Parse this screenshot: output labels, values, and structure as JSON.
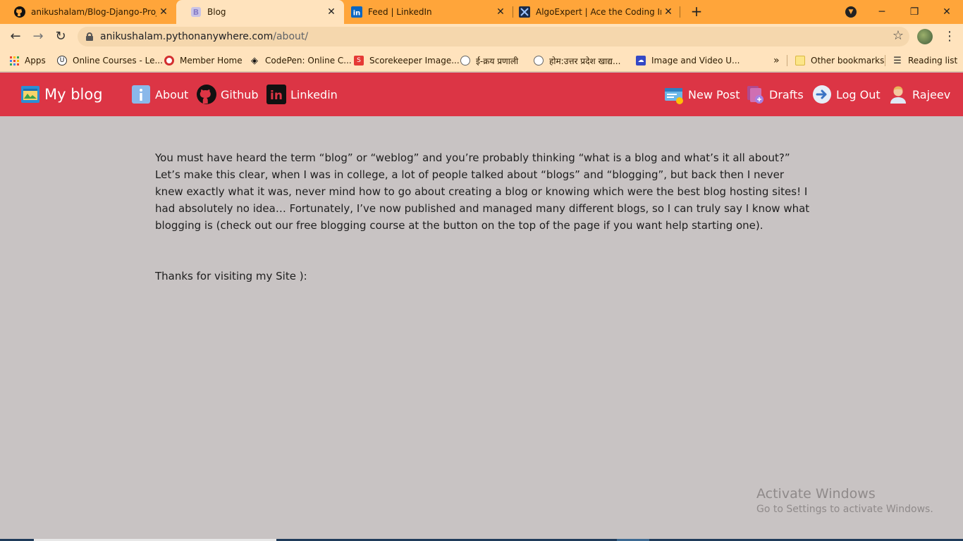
{
  "browser": {
    "tabs": [
      {
        "title": "anikushalam/Blog-Django-Projec",
        "icon": "github-icon",
        "active": false
      },
      {
        "title": "Blog",
        "icon": "bootstrap-icon",
        "active": true
      },
      {
        "title": "Feed | LinkedIn",
        "icon": "linkedin-icon",
        "active": false
      },
      {
        "title": "AlgoExpert | Ace the Coding Inte",
        "icon": "algoexpert-icon",
        "active": false
      }
    ],
    "new_tab": "+",
    "window_controls": {
      "minimize": "─",
      "restore": "❐",
      "close": "✕"
    },
    "url_host": "anikushalam.pythonanywhere.com",
    "url_path": "/about/",
    "bookmarks": [
      {
        "label": "Apps",
        "icon": "apps-grid-icon"
      },
      {
        "label": "Online Courses - Le...",
        "icon": "udemy-icon"
      },
      {
        "label": "Member Home",
        "icon": "member-home-icon"
      },
      {
        "label": "CodePen: Online C...",
        "icon": "codepen-icon"
      },
      {
        "label": "Scorekeeper Image...",
        "icon": "scorekeeper-icon"
      },
      {
        "label": "ई-क्रय प्रणाली",
        "icon": "up-emblem-icon"
      },
      {
        "label": "होम:उत्तर प्रदेश खाद्य...",
        "icon": "up-emblem-icon"
      },
      {
        "label": "Image and Video U...",
        "icon": "cloud-upload-icon"
      }
    ],
    "more_bookmarks": "»",
    "other_bookmarks": "Other bookmarks",
    "reading_list": "Reading list"
  },
  "navbar": {
    "brand": "My blog",
    "left_items": [
      {
        "label": "About",
        "icon": "info-icon"
      },
      {
        "label": "Github",
        "icon": "github-icon"
      },
      {
        "label": "Linkedin",
        "icon": "linkedin-icon"
      }
    ],
    "right_items": [
      {
        "label": "New Post",
        "icon": "new-post-icon"
      },
      {
        "label": "Drafts",
        "icon": "drafts-icon"
      },
      {
        "label": "Log Out",
        "icon": "logout-arrow-icon"
      },
      {
        "label": "Rajeev",
        "icon": "user-avatar-icon"
      }
    ]
  },
  "content": {
    "paragraph": "You must have heard the term “blog” or “weblog” and you’re probably thinking “what is a blog and what’s it all about?” Let’s make this clear, when I was in college, a lot of people talked about “blogs” and “blogging”, but back then I never knew exactly what it was, never mind how to go about creating a blog or knowing which were the best blog hosting sites! I had absolutely no idea… Fortunately, I’ve now published and managed many different blogs, so I can truly say I know what blogging is (check out our free blogging course at the button on the top of the page if you want help starting one).",
    "thanks": "Thanks for visiting my Site ):"
  },
  "watermark": {
    "line1": "Activate Windows",
    "line2": "Go to Settings to activate Windows."
  },
  "colors": {
    "tab_strip": "#ffa53a",
    "toolbar": "#ffe3bd",
    "navbar": "#dc3545",
    "page_bg": "#c8c3c3"
  }
}
